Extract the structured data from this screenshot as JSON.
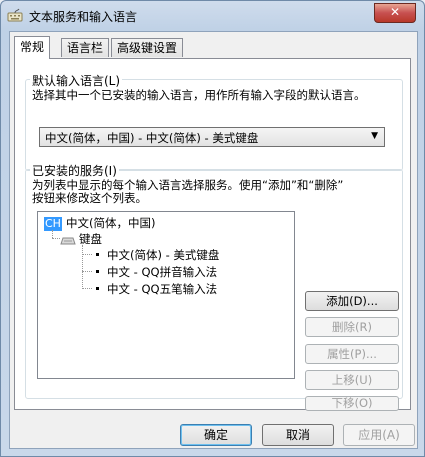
{
  "window": {
    "title": "文本服务和输入语言",
    "close_symbol": "✕"
  },
  "tabs": [
    {
      "label": "常规"
    },
    {
      "label": "语言栏"
    },
    {
      "label": "高级键设置"
    }
  ],
  "default_language": {
    "group_title": "默认输入语言(L)",
    "description": "选择其中一个已安装的输入语言，用作所有输入字段的默认语言。",
    "selected": "中文(简体，中国) - 中文(简体) - 美式键盘"
  },
  "installed_services": {
    "group_title": "已安装的服务(I)",
    "description_line1": "为列表中显示的每个输入语言选择服务。使用“添加”和“删除”",
    "description_line2": "按钮来修改这个列表。",
    "tree": {
      "language_badge": "CH",
      "language": "中文(简体，中国)",
      "category": "键盘",
      "items": [
        "中文(简体) - 美式键盘",
        "中文 - QQ拼音输入法",
        "中文 - QQ五笔输入法"
      ]
    },
    "buttons": {
      "add": "添加(D)...",
      "remove": "删除(R)",
      "properties": "属性(P)...",
      "move_up": "上移(U)",
      "move_down": "下移(O)"
    }
  },
  "footer": {
    "ok": "确定",
    "cancel": "取消",
    "apply": "应用(A)"
  }
}
